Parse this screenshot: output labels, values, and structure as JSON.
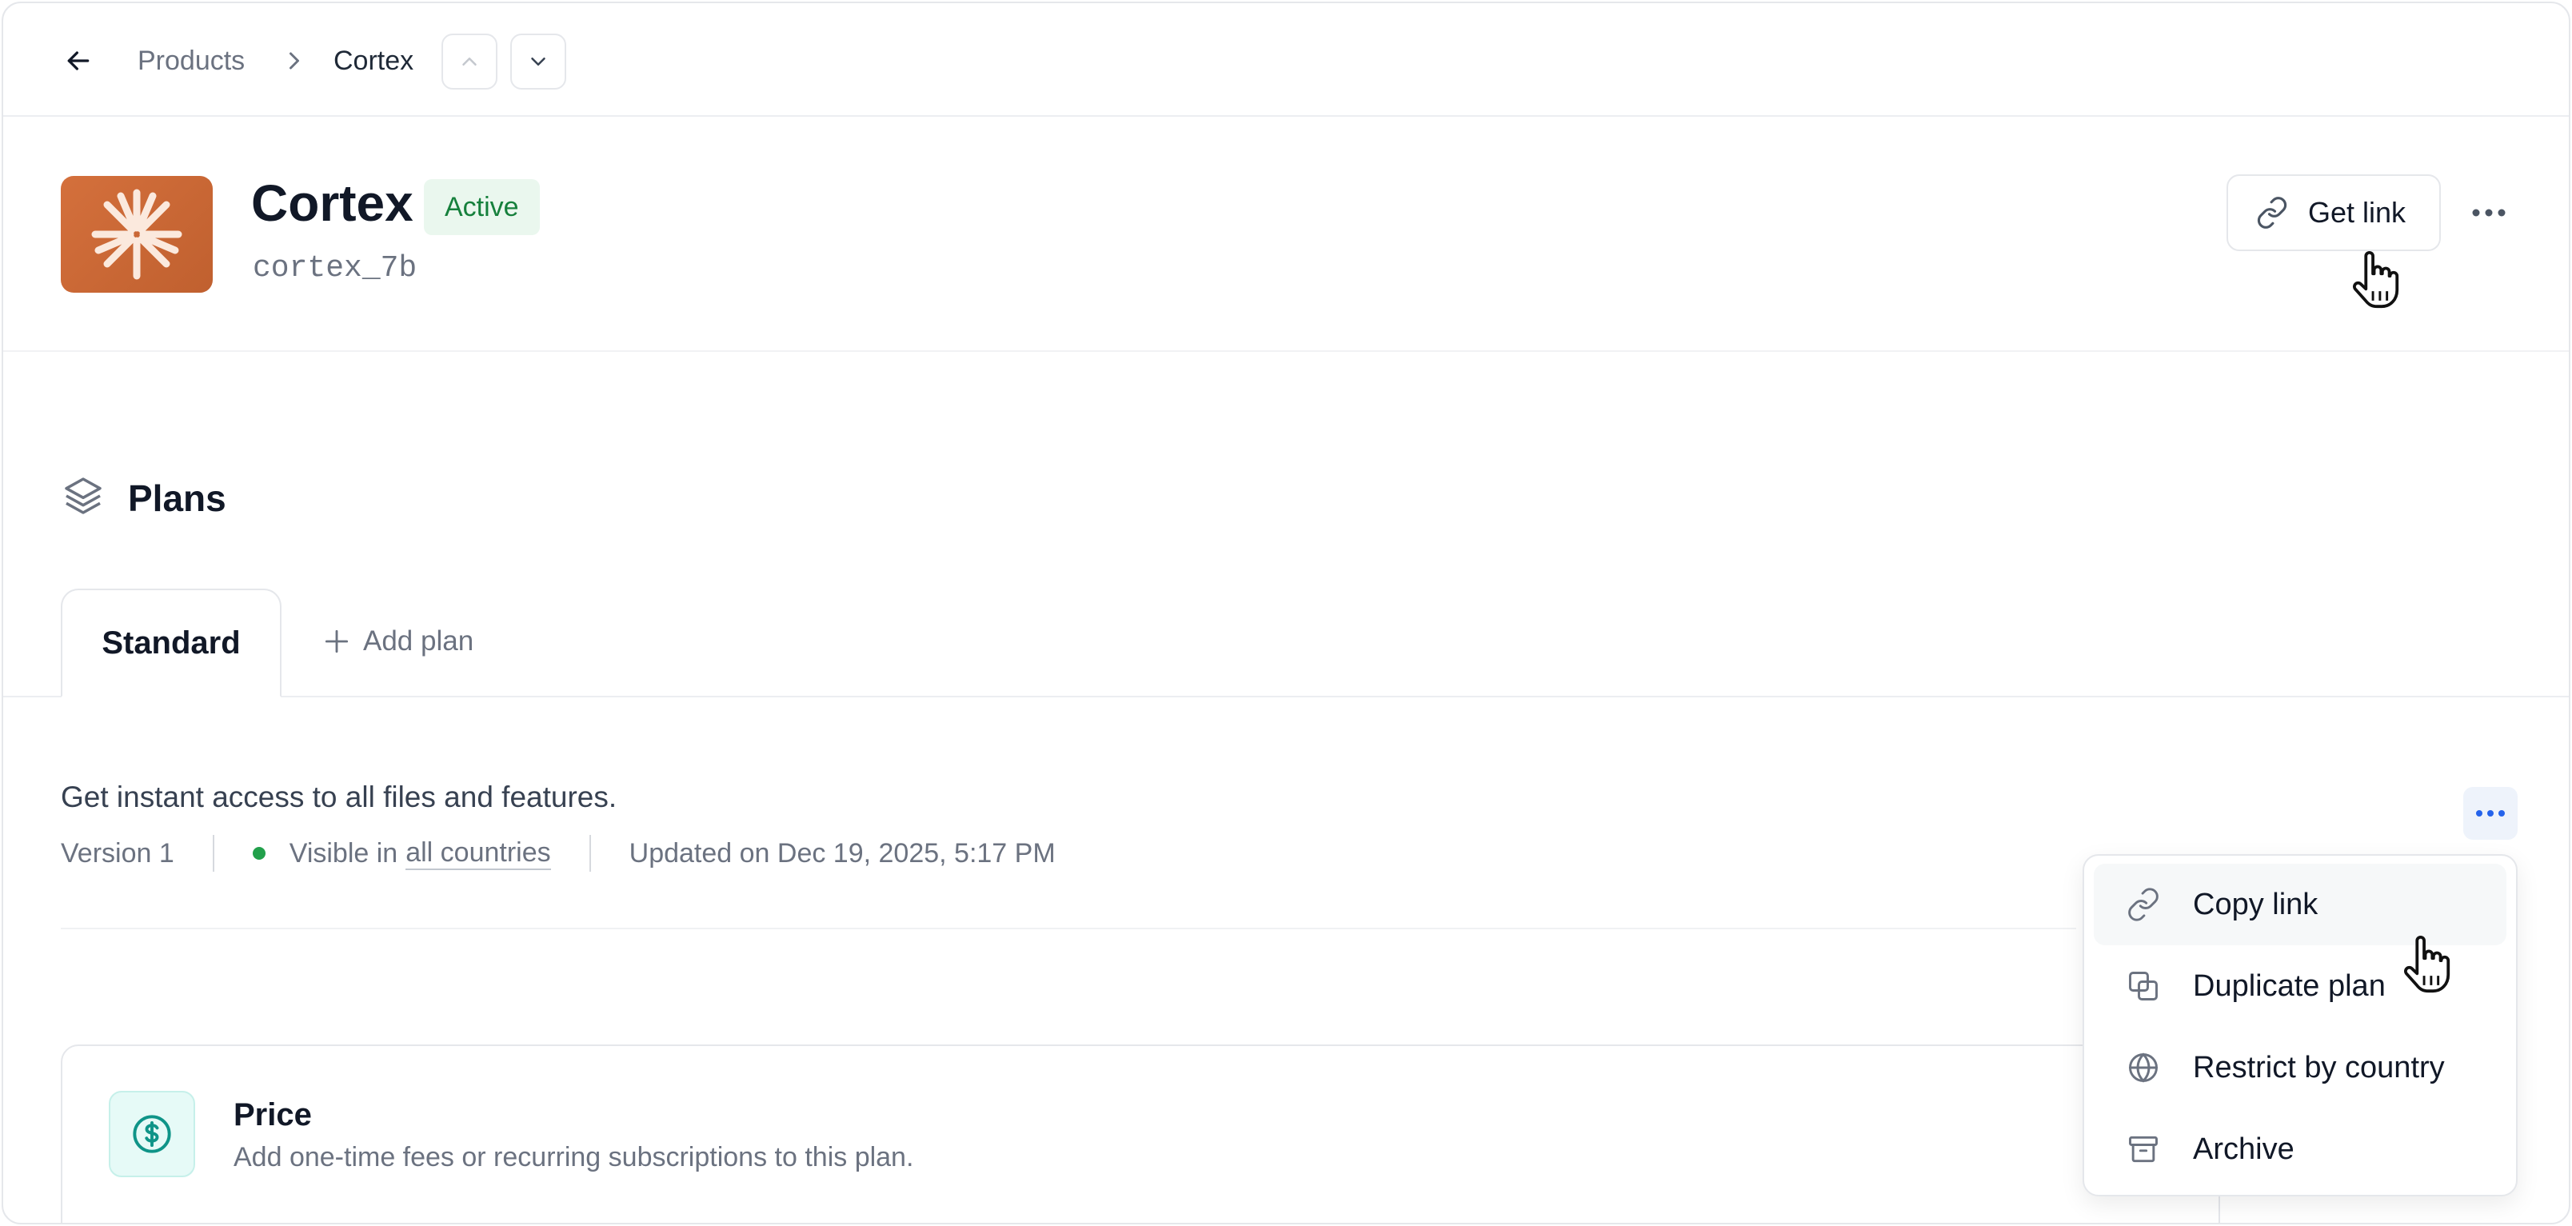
{
  "breadcrumb": {
    "back_icon": "arrow-left-icon",
    "products": "Products",
    "current": "Cortex",
    "separator_icon": "chevron-right-icon",
    "prev_icon": "chevron-up-icon",
    "next_icon": "chevron-down-icon"
  },
  "product": {
    "name": "Cortex",
    "status": "Active",
    "slug": "cortex_7b",
    "logo_icon": "starburst-icon",
    "logo_color": "#c96634",
    "status_color": "#16803c"
  },
  "header_actions": {
    "get_link_label": "Get link",
    "more_icon": "more-horizontal-icon"
  },
  "plans": {
    "title": "Plans",
    "icon": "layers-icon",
    "tabs": [
      {
        "label": "Standard",
        "active": true
      }
    ],
    "add_plan_label": "Add plan",
    "description": "Get instant access to all files and features.",
    "version": "Version 1",
    "visibility_prefix": "Visible in",
    "visibility_link": "all countries",
    "updated": "Updated on Dec 19, 2025, 5:17 PM",
    "visibility_color": "#22a04b"
  },
  "price_card": {
    "title": "Price",
    "subtitle": "Add one-time fees or recurring subscriptions to this plan.",
    "icon": "dollar-circle-icon"
  },
  "plan_menu": {
    "items": [
      {
        "label": "Copy link",
        "icon": "link-icon"
      },
      {
        "label": "Duplicate plan",
        "icon": "duplicate-icon"
      },
      {
        "label": "Restrict by country",
        "icon": "globe-icon"
      },
      {
        "label": "Archive",
        "icon": "archive-icon"
      }
    ]
  }
}
